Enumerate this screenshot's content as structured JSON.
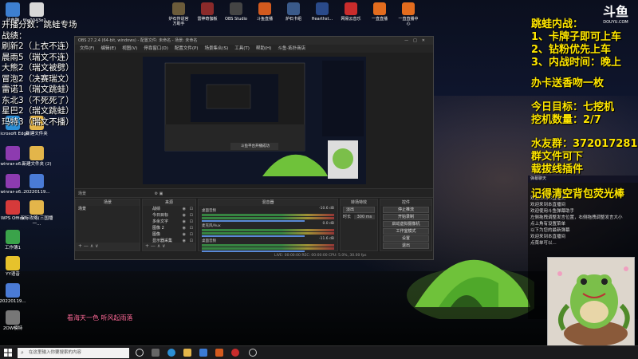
{
  "overlay_left": {
    "title": "开播分数：跳蛙专场",
    "lines": [
      "战绩：",
      "刷新2（上衣不连）",
      "晨雨5（瑞文不连）",
      "大熊2（瑞文被劈）",
      "冒泡2（决赛瑞文）",
      "雷诺1（瑞文跳蛙）",
      "东北3（不死死了）",
      "星巴2（瑞文跳蛙）",
      "玛特3（瑞文不播）"
    ]
  },
  "overlay_right": {
    "lines_yellow": [
      "跳蛙内战：",
      "1、卡牌子即可上车",
      "2、钻粉优先上车",
      "3、内战时间：晚上"
    ],
    "line_card": "办卡送香吻一枚",
    "target": "今日目标：七挖机",
    "count": "挖机数量：2/7",
    "group": "水友群：372017281",
    "file": "群文件可下",
    "plugin": "载拔线插件",
    "clear": "记得清空背包荧光棒"
  },
  "logo": {
    "text": "斗鱼",
    "sub": "DOUYU.COM"
  },
  "bottom_caption": "看海天一色 听风起雨落",
  "desktop_icons": [
    {
      "label": "此电脑",
      "color": "#3d7fd1"
    },
    {
      "label": "file0043e1...",
      "color": "#d8d8d8"
    },
    {
      "label": "Microsoft Edge",
      "color": "#2b8fd6"
    },
    {
      "label": "新建文件夹",
      "color": "#e3b54a"
    },
    {
      "label": "winrar-x6...",
      "color": "#8d3bb0"
    },
    {
      "label": "新建文件夹 (2)",
      "color": "#e3b54a"
    },
    {
      "label": "winrar-x6...",
      "color": "#8d3bb0"
    },
    {
      "label": "20220119...",
      "color": "#4a7bd6"
    },
    {
      "label": "WPS Office",
      "color": "#d63a3a"
    },
    {
      "label": "双标攻略(三国播一...",
      "color": "#e3b54a"
    },
    {
      "label": "工作簿1",
      "color": "#3aa34a"
    },
    {
      "label": "YY语音",
      "color": "#e6c22c"
    },
    {
      "label": "20220119...",
      "color": "#4a7bd6"
    },
    {
      "label": "2OW模特",
      "color": "#777"
    }
  ],
  "top_icons": [
    {
      "label": "炉石传说官方助手",
      "color": "#6b5b3a"
    },
    {
      "label": "雷神奇伽板",
      "color": "#8a2a2a"
    },
    {
      "label": "OBS Studio",
      "color": "#444"
    },
    {
      "label": "斗鱼直播",
      "color": "#d35a1e"
    },
    {
      "label": "炉石卡组",
      "color": "#3a5a8a"
    },
    {
      "label": "Hearthst...",
      "color": "#2a4a8a"
    },
    {
      "label": "网易云音乐",
      "color": "#c92c2c"
    },
    {
      "label": "一直直播",
      "color": "#e36c1e"
    },
    {
      "label": "一直直播中心",
      "color": "#e36c1e"
    }
  ],
  "obs": {
    "title": "OBS 27.2.4 (64-bit, windows) - 配置文件: 未命名 - 场景: 未命名",
    "menu": [
      "文件(F)",
      "编辑(E)",
      "视图(V)",
      "停靠窗口(D)",
      "配置文件(P)",
      "场景集合(S)",
      "工具(T)",
      "帮助(H)",
      "斗鱼·拓扑商店"
    ],
    "preview_popup": "斗鱼平台开播成功",
    "panels": {
      "scenes_title": "场景",
      "scenes": [
        "场景"
      ],
      "sources_title": "来源",
      "sources": [
        "战绩",
        "今日目标",
        "多余文字",
        "图像 2",
        "图像",
        "显示器采集"
      ],
      "mixer_title": "混音器",
      "mixer": [
        {
          "name": "桌面音频",
          "db": "-10.6 dB"
        },
        {
          "name": "麦克风/Aux",
          "db": "0.0 dB"
        },
        {
          "name": "桌面音频",
          "db": "-11.6 dB"
        }
      ],
      "transition_title": "转场特效",
      "transition_name": "淡出",
      "duration_label": "时长",
      "duration_value": "300 ms",
      "controls_title": "控件",
      "controls": [
        "停止推流",
        "开始录制",
        "启动虚拟摄像机",
        "工作室模式",
        "设置",
        "退出"
      ]
    },
    "bottom_toolbar_scenes": "+ — ∧ ∨",
    "status": "LIVE: 00:00:00   REC: 00:00:00   CPU: 5.0%, 30.00 fps"
  },
  "chat": {
    "header": "弹幕聊天",
    "lines": [
      "欢迎来到本直播间",
      "欢迎来到本直播间",
      "欢迎使用斗鱼弹幕助手",
      "左侧拖拽调整发言位置，右侧拖拽调整发言大小",
      "点上角有设置菜单",
      "以下为您的最新弹幕",
      "",
      "",
      "欢迎来到本直播间",
      "点菜单可以..."
    ]
  },
  "taskbar": {
    "search_placeholder": "在这里输入你要搜索的内容"
  }
}
